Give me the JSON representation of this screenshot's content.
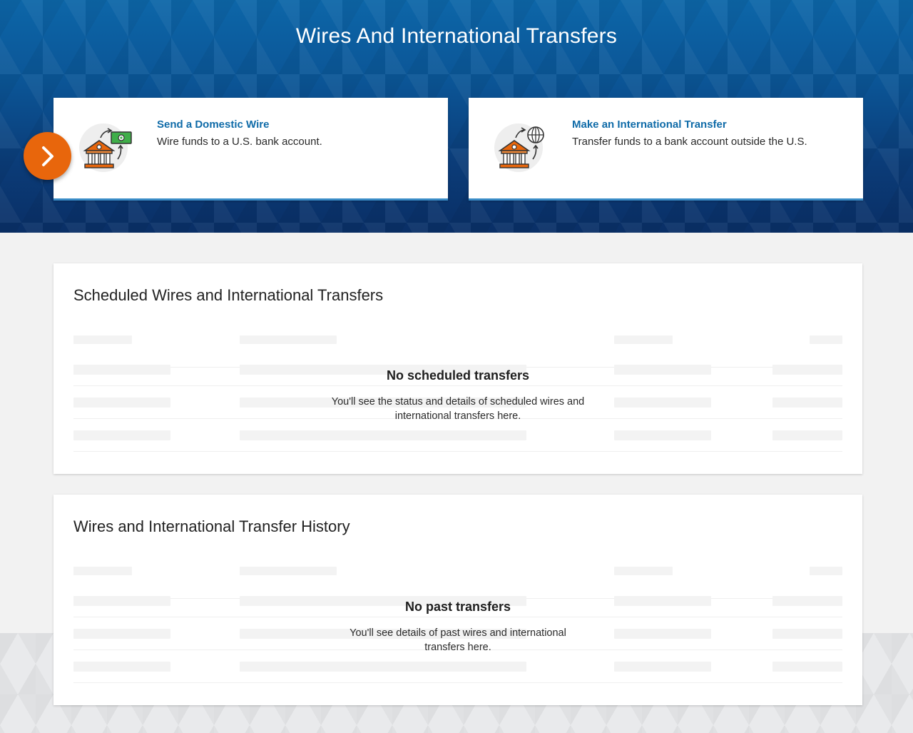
{
  "hero": {
    "title": "Wires And International Transfers"
  },
  "actions": {
    "domestic": {
      "title": "Send a Domestic Wire",
      "description": "Wire funds to a U.S. bank account.",
      "icon": "bank-money-icon"
    },
    "international": {
      "title": "Make an International Transfer",
      "description": "Transfer funds to a bank account outside the U.S.",
      "icon": "bank-globe-icon"
    },
    "badge_icon": "chevron-right-icon"
  },
  "scheduled": {
    "title": "Scheduled Wires and International Transfers",
    "empty_title": "No scheduled transfers",
    "empty_text": "You'll see the status and details of scheduled wires and international transfers here."
  },
  "history": {
    "title": "Wires and International Transfer History",
    "empty_title": "No past transfers",
    "empty_text": "You'll see details of past wires and international transfers here."
  },
  "colors": {
    "hero_top": "#0d66a8",
    "hero_bottom": "#0a2f66",
    "link_blue": "#0f6ba8",
    "accent_orange": "#e8660c",
    "money_green": "#3fae49"
  }
}
